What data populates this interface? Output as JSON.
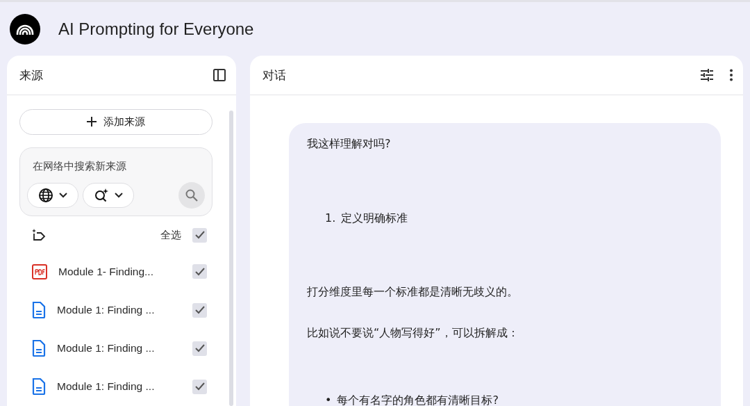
{
  "header": {
    "title": "AI Prompting for Everyone"
  },
  "sources_panel": {
    "title": "来源",
    "add_button": "添加来源",
    "web_search": {
      "placeholder": "在网络中搜索新来源"
    },
    "select_all": {
      "label": "全选",
      "checked": true
    },
    "items": [
      {
        "kind": "pdf",
        "name": "Module 1- Finding...",
        "checked": true
      },
      {
        "kind": "doc",
        "name": "Module 1: Finding ...",
        "checked": true
      },
      {
        "kind": "doc",
        "name": "Module 1: Finding ...",
        "checked": true
      },
      {
        "kind": "doc",
        "name": "Module 1: Finding ...",
        "checked": true
      }
    ]
  },
  "chat_panel": {
    "title": "对话",
    "message": [
      {
        "kind": "text",
        "text": "我这样理解对吗?"
      },
      {
        "kind": "numbered",
        "marker": "1.",
        "text": "定义明确标准"
      },
      {
        "kind": "text",
        "text": "打分维度里每一个标准都是清晰无歧义的。"
      },
      {
        "kind": "text",
        "text": "比如说不要说“人物写得好”，可以拆解成："
      },
      {
        "kind": "bullet",
        "marker": "•",
        "text": "每个有名字的角色都有清晰目标?"
      }
    ]
  }
}
